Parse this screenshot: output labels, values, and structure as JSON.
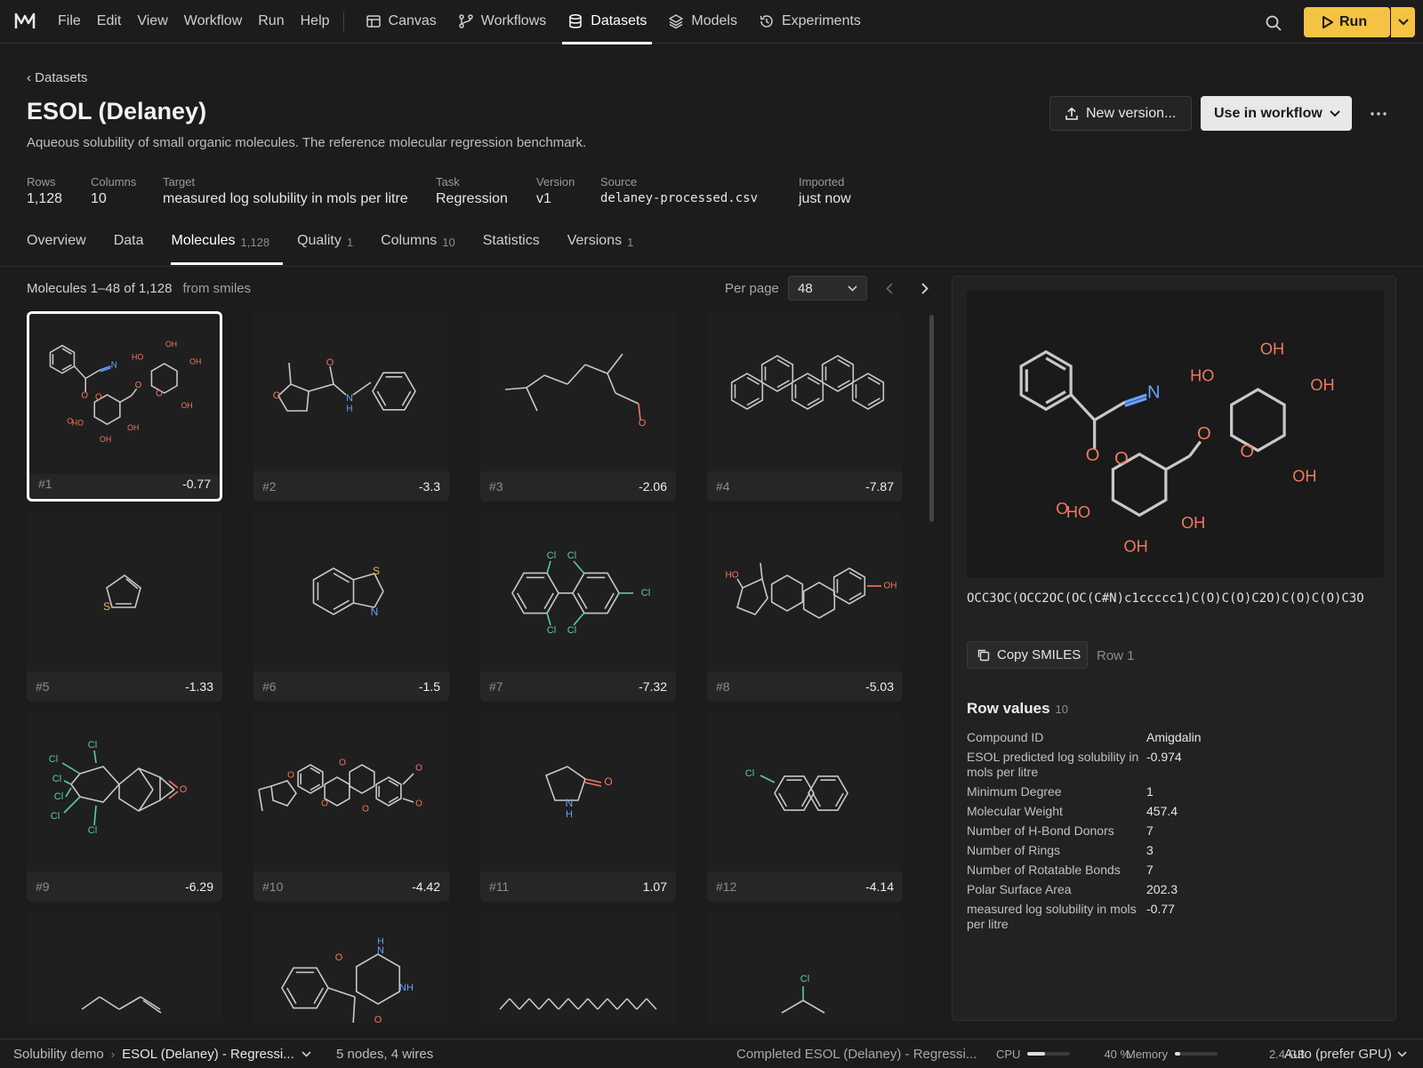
{
  "menu": [
    "File",
    "Edit",
    "View",
    "Workflow",
    "Run",
    "Help"
  ],
  "nav_tabs": [
    {
      "label": "Canvas",
      "icon": "canvas-icon"
    },
    {
      "label": "Workflows",
      "icon": "workflow-icon"
    },
    {
      "label": "Datasets",
      "icon": "database-icon",
      "active": true
    },
    {
      "label": "Models",
      "icon": "layers-icon"
    },
    {
      "label": "Experiments",
      "icon": "history-icon"
    }
  ],
  "run_label": "Run",
  "accent_color": "#f5c343",
  "breadcrumb": "‹ Datasets",
  "title": "ESOL (Delaney)",
  "subtitle": "Aqueous solubility of small organic molecules. The reference molecular regression benchmark.",
  "actions": {
    "new_version": "New version...",
    "use_in_workflow": "Use in workflow"
  },
  "stats": [
    {
      "label": "Rows",
      "value": "1,128"
    },
    {
      "label": "Columns",
      "value": "10"
    },
    {
      "label": "Target",
      "value": "measured log solubility in mols per litre"
    },
    {
      "label": "Task",
      "value": "Regression"
    },
    {
      "label": "Version",
      "value": "v1"
    },
    {
      "label": "Source",
      "value": "delaney-processed.csv"
    },
    {
      "label": "Imported",
      "value": "just now"
    }
  ],
  "tabs": [
    {
      "label": "Overview",
      "count": ""
    },
    {
      "label": "Data",
      "count": ""
    },
    {
      "label": "Molecules",
      "count": "1,128",
      "active": true
    },
    {
      "label": "Quality",
      "count": "1"
    },
    {
      "label": "Columns",
      "count": "10"
    },
    {
      "label": "Statistics",
      "count": ""
    },
    {
      "label": "Versions",
      "count": "1"
    }
  ],
  "molecules_header": {
    "range": "Molecules 1–48 of 1,128",
    "source": "from smiles",
    "per_page_label": "Per page",
    "per_page": "48"
  },
  "cards": [
    {
      "index": "#1",
      "value": "-0.77",
      "mol": "amygdalin"
    },
    {
      "index": "#2",
      "value": "-3.3",
      "mol": "furanamide"
    },
    {
      "index": "#3",
      "value": "-2.06",
      "mol": "citral"
    },
    {
      "index": "#4",
      "value": "-7.87",
      "mol": "chrysene"
    },
    {
      "index": "#5",
      "value": "-1.33",
      "mol": "thiophene"
    },
    {
      "index": "#6",
      "value": "-1.5",
      "mol": "benzothiazole"
    },
    {
      "index": "#7",
      "value": "-7.32",
      "mol": "pcb"
    },
    {
      "index": "#8",
      "value": "-5.03",
      "mol": "estradiol"
    },
    {
      "index": "#9",
      "value": "-6.29",
      "mol": "dieldrin"
    },
    {
      "index": "#10",
      "value": "-4.42",
      "mol": "rotenone"
    },
    {
      "index": "#11",
      "value": "1.07",
      "mol": "pyrrolidone"
    },
    {
      "index": "#12",
      "value": "-4.14",
      "mol": "chloronaphthalene"
    },
    {
      "index": "",
      "value": "",
      "mol": "pentene"
    },
    {
      "index": "",
      "value": "",
      "mol": "phenobarbital"
    },
    {
      "index": "",
      "value": "",
      "mol": "alkane"
    },
    {
      "index": "",
      "value": "",
      "mol": "chloropropane"
    }
  ],
  "atom_labels": {
    "O": "O",
    "N": "N",
    "S": "S",
    "Cl": "Cl",
    "OH": "OH",
    "HO": "HO",
    "H": "H",
    "NH": "NH"
  },
  "panel": {
    "smiles": "OCC3OC(OCC2OC(OC(C#N)c1ccccc1)C(O)C(O)C2O)C(O)C(O)C3O",
    "copy_label": "Copy SMILES",
    "row_label": "Row 1",
    "row_values_title": "Row values",
    "row_values_count": "10",
    "row_values": [
      {
        "k": "Compound ID",
        "v": "Amigdalin"
      },
      {
        "k": "ESOL predicted log solubility in mols per litre",
        "v": "-0.974"
      },
      {
        "k": "Minimum Degree",
        "v": "1"
      },
      {
        "k": "Molecular Weight",
        "v": "457.4"
      },
      {
        "k": "Number of H-Bond Donors",
        "v": "7"
      },
      {
        "k": "Number of Rings",
        "v": "3"
      },
      {
        "k": "Number of Rotatable Bonds",
        "v": "7"
      },
      {
        "k": "Polar Surface Area",
        "v": "202.3"
      },
      {
        "k": "measured log solubility in mols per litre",
        "v": "-0.77"
      }
    ]
  },
  "statusbar": {
    "project": "Solubility demo",
    "workflow": "ESOL (Delaney) - Regressi...",
    "nodes": "5 nodes, 4 wires",
    "status": "Completed ESOL (Delaney) - Regressi...",
    "cpu_label": "CPU",
    "cpu_value": "40 %",
    "cpu_fraction": 0.4,
    "mem_label": "Memory",
    "mem_value": "2.4 GB",
    "mem_fraction": 0.05,
    "device": "Auto (prefer GPU)"
  }
}
